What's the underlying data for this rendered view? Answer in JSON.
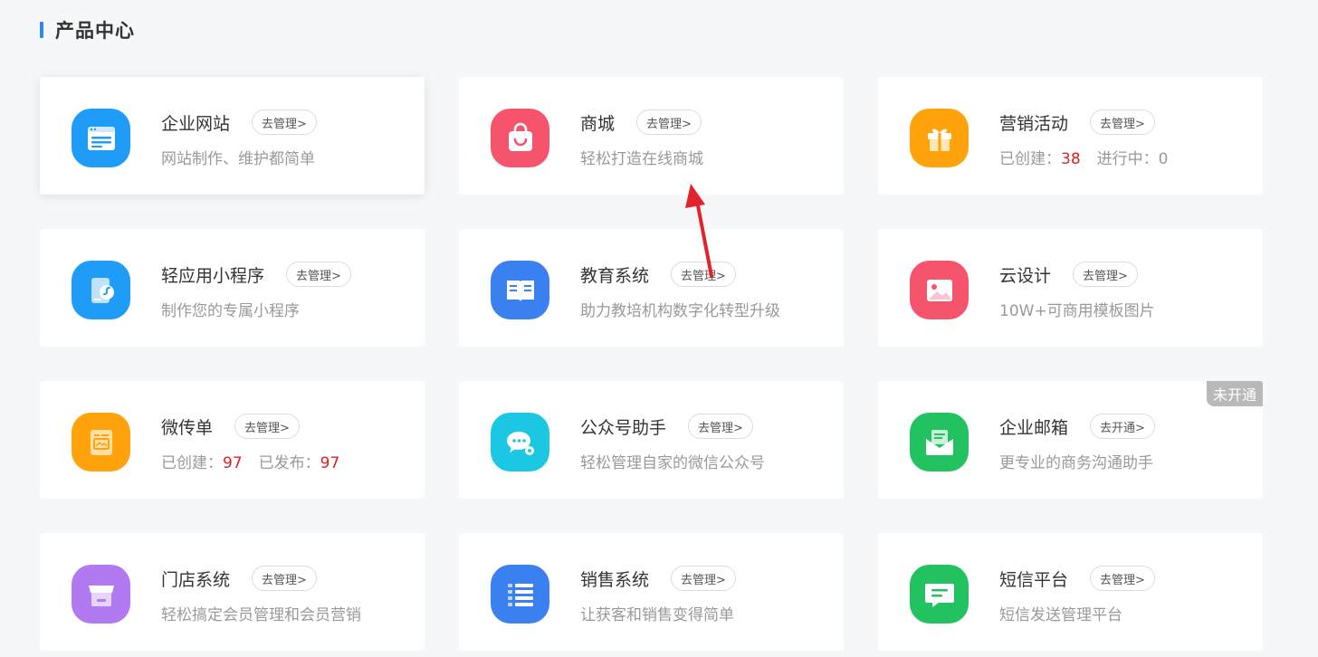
{
  "section": {
    "title": "产品中心"
  },
  "cards": [
    {
      "title": "企业网站",
      "button": "去管理>",
      "desc": "网站制作、维护都简单",
      "icon": "website-icon",
      "color": "#1e9cf7"
    },
    {
      "title": "商城",
      "button": "去管理>",
      "desc": "轻松打造在线商城",
      "icon": "shopping-bag-icon",
      "color": "#f5546c"
    },
    {
      "title": "营销活动",
      "button": "去管理>",
      "stats": [
        {
          "label": "已创建：",
          "value": "38"
        },
        {
          "label": "进行中：",
          "value": "0"
        }
      ],
      "icon": "gift-icon",
      "color": "#ffa20c"
    },
    {
      "title": "轻应用小程序",
      "button": "去管理>",
      "desc": "制作您的专属小程序",
      "icon": "miniprogram-icon",
      "color": "#1e9cf7"
    },
    {
      "title": "教育系统",
      "button": "去管理>",
      "desc": "助力教培机构数字化转型升级",
      "icon": "book-icon",
      "color": "#3a80f0"
    },
    {
      "title": "云设计",
      "button": "去管理>",
      "desc": "10W+可商用模板图片",
      "icon": "image-icon",
      "color": "#f5546c"
    },
    {
      "title": "微传单",
      "button": "去管理>",
      "stats": [
        {
          "label": "已创建：",
          "value": "97"
        },
        {
          "label": "已发布：",
          "value": "97"
        }
      ],
      "icon": "flyer-icon",
      "color": "#ffa20c"
    },
    {
      "title": "公众号助手",
      "button": "去管理>",
      "desc": "轻松管理自家的微信公众号",
      "icon": "wechat-chat-icon",
      "color": "#1cc7e4"
    },
    {
      "title": "企业邮箱",
      "button": "去开通>",
      "desc": "更专业的商务沟通助手",
      "icon": "mail-icon",
      "color": "#23c261",
      "badge": "未开通"
    },
    {
      "title": "门店系统",
      "button": "去管理>",
      "desc": "轻松搞定会员管理和会员营销",
      "icon": "store-icon",
      "color": "#b27af0"
    },
    {
      "title": "销售系统",
      "button": "去管理>",
      "desc": "让获客和销售变得简单",
      "icon": "list-icon",
      "color": "#3a80f0"
    },
    {
      "title": "短信平台",
      "button": "去管理>",
      "desc": "短信发送管理平台",
      "icon": "sms-icon",
      "color": "#23c261"
    }
  ]
}
